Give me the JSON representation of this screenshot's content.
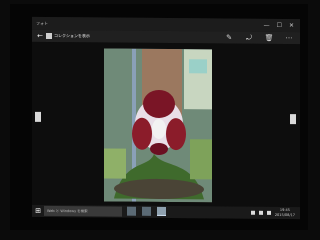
{
  "window": {
    "app_name": "フォト",
    "controls": [
      "—",
      "☐",
      "✕"
    ]
  },
  "cmdbar": {
    "back_icon": "back-arrow-icon",
    "collection_label": "コレクションを表示",
    "tools": [
      "✎",
      "⤾",
      "🗑",
      "⋯"
    ]
  },
  "taskbar": {
    "start_icon": "windows-logo-icon",
    "search_placeholder": "Web と Windows を検索",
    "time": "19:45",
    "date": "2015/08/17"
  },
  "colors": {
    "titlebar": "#1c1c1c",
    "taskbar": "#1a1a1a",
    "search": "#3a3a3a"
  }
}
